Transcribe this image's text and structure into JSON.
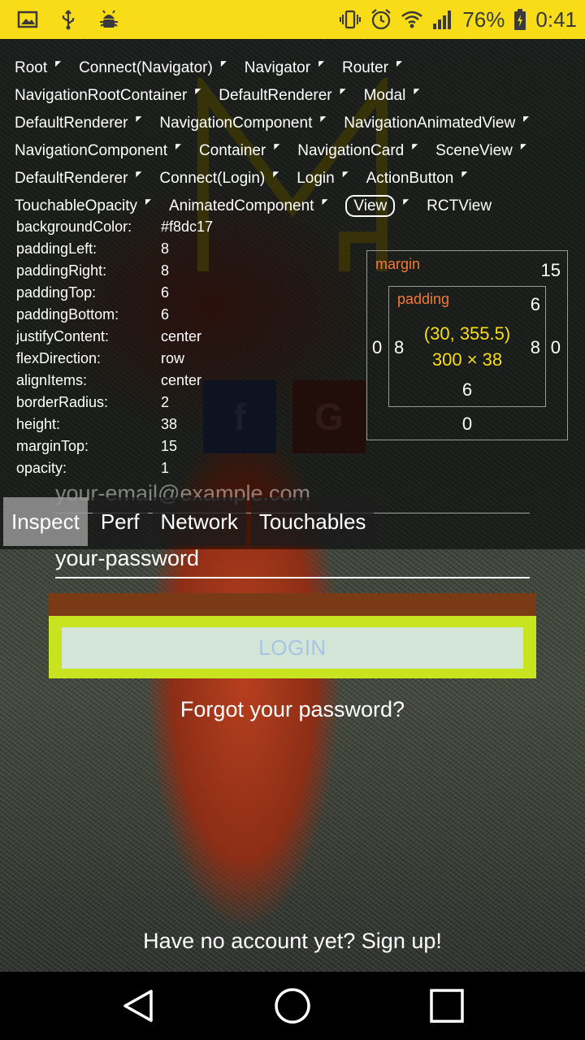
{
  "status_bar": {
    "left_icons": [
      "image-icon",
      "usb-icon",
      "android-debug-icon"
    ],
    "right_icons": [
      "vibrate-icon",
      "alarm-icon",
      "wifi-icon",
      "signal-icon"
    ],
    "battery": "76%",
    "time": "0:41",
    "background": "#f8dc17"
  },
  "inspector": {
    "breadcrumb": [
      {
        "label": "Root"
      },
      {
        "label": "Connect(Navigator)"
      },
      {
        "label": "Navigator"
      },
      {
        "label": "Router"
      },
      {
        "label": "NavigationRootContainer"
      },
      {
        "label": "DefaultRenderer"
      },
      {
        "label": "Modal"
      },
      {
        "label": "DefaultRenderer"
      },
      {
        "label": "NavigationComponent"
      },
      {
        "label": "NavigationAnimatedView"
      },
      {
        "label": "NavigationComponent"
      },
      {
        "label": "Container"
      },
      {
        "label": "NavigationCard"
      },
      {
        "label": "SceneView"
      },
      {
        "label": "DefaultRenderer"
      },
      {
        "label": "Connect(Login)"
      },
      {
        "label": "Login"
      },
      {
        "label": "ActionButton"
      },
      {
        "label": "TouchableOpacity"
      },
      {
        "label": "AnimatedComponent"
      },
      {
        "label": "View"
      },
      {
        "label": "RCTView"
      }
    ],
    "selected_crumb": "View",
    "style_props": [
      {
        "key": "backgroundColor:",
        "value": "#f8dc17"
      },
      {
        "key": "paddingLeft:",
        "value": "8"
      },
      {
        "key": "paddingRight:",
        "value": "8"
      },
      {
        "key": "paddingTop:",
        "value": "6"
      },
      {
        "key": "paddingBottom:",
        "value": "6"
      },
      {
        "key": "justifyContent:",
        "value": "center"
      },
      {
        "key": "flexDirection:",
        "value": "row"
      },
      {
        "key": "alignItems:",
        "value": "center"
      },
      {
        "key": "borderRadius:",
        "value": "2"
      },
      {
        "key": "height:",
        "value": "38"
      },
      {
        "key": "marginTop:",
        "value": "15"
      },
      {
        "key": "opacity:",
        "value": "1"
      }
    ],
    "box_model": {
      "margin_label": "margin",
      "margin_top": "15",
      "margin_left": "0",
      "margin_right": "0",
      "margin_bottom": "0",
      "padding_label": "padding",
      "padding_top": "6",
      "padding_left": "8",
      "padding_right": "8",
      "padding_bottom": "6",
      "content_position": "(30, 355.5)",
      "content_size": "300 × 38"
    },
    "tabs": [
      {
        "label": "Inspect",
        "active": true
      },
      {
        "label": "Perf",
        "active": false
      },
      {
        "label": "Network",
        "active": false
      },
      {
        "label": "Touchables",
        "active": false
      }
    ]
  },
  "login_form": {
    "social": {
      "facebook_glyph": "f",
      "google_glyph": "G"
    },
    "email_placeholder": "your-email@example.com",
    "password_value": "your-password",
    "login_label": "LOGIN",
    "forgot_link": "Forgot your password?",
    "signup_link": "Have no account yet? Sign up!",
    "highlight_color": "#c8e31f",
    "accent_color": "#f8dc17"
  },
  "nav_bar": {
    "buttons": [
      "back-icon",
      "home-icon",
      "recents-icon"
    ]
  }
}
